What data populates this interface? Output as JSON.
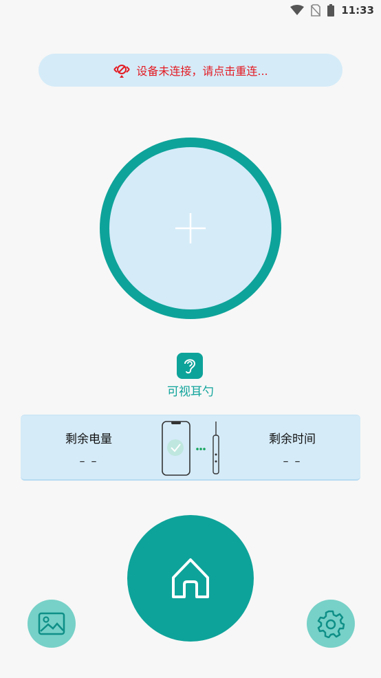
{
  "status_bar": {
    "time": "11:33",
    "icons": [
      "wifi-icon",
      "no-sim-icon",
      "battery-icon"
    ]
  },
  "connection": {
    "message": "设备未连接，请点击重连...",
    "icon": "disconnected-icon",
    "color": "#e31b23"
  },
  "camera": {
    "add_icon": "plus-icon"
  },
  "mode": {
    "icon": "ear-icon",
    "label": "可视耳勺"
  },
  "info": {
    "battery_title": "剩余电量",
    "battery_value": "– –",
    "time_title": "剩余时间",
    "time_value": "– –",
    "illustration": "phone-to-device-icon"
  },
  "bottom_nav": {
    "gallery_icon": "gallery-icon",
    "home_icon": "home-icon",
    "settings_icon": "gear-icon"
  },
  "colors": {
    "accent": "#0ea39a",
    "light_accent": "#77d1c8",
    "panel": "#d5ebf8",
    "background": "#f7f7f7"
  }
}
